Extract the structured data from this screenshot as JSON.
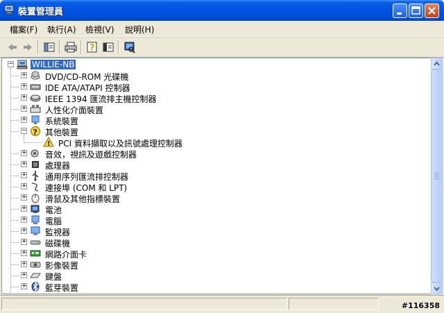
{
  "window": {
    "title": "裝置管理員"
  },
  "menu": [
    {
      "label": "檔案(F)"
    },
    {
      "label": "執行(A)"
    },
    {
      "label": "檢視(V)"
    },
    {
      "label": "說明(H)"
    }
  ],
  "toolbar": [
    {
      "icon": "back-arrow-icon"
    },
    {
      "icon": "forward-arrow-icon"
    },
    {
      "icon": "show-hide-console-tree-icon"
    },
    {
      "icon": "print-icon"
    },
    {
      "icon": "help-icon"
    },
    {
      "icon": "properties-icon"
    },
    {
      "icon": "scan-hardware-icon"
    }
  ],
  "tree": {
    "root": {
      "label": "WILLIE-NB",
      "expanded": true
    },
    "items": [
      {
        "label": "DVD/CD-ROM 光碟機",
        "icon": "cdrom-icon",
        "expander": "+"
      },
      {
        "label": "IDE ATA/ATAPI 控制器",
        "icon": "ide-controller-icon",
        "expander": "+"
      },
      {
        "label": "IEEE 1394 匯流排主機控制器",
        "icon": "firewire-icon",
        "expander": "+"
      },
      {
        "label": "人性化介面裝置",
        "icon": "hid-icon",
        "expander": "+"
      },
      {
        "label": "系統裝置",
        "icon": "system-device-icon",
        "expander": "+"
      },
      {
        "label": "其他裝置",
        "icon": "other-devices-question-icon",
        "expander": "-"
      },
      {
        "label": "PCI 資料擷取以及訊號處理控制器",
        "icon": "unknown-device-warning-icon",
        "expander": "",
        "child": true
      },
      {
        "label": "音效，視訊及遊戲控制器",
        "icon": "sound-icon",
        "expander": "+"
      },
      {
        "label": "處理器",
        "icon": "processor-icon",
        "expander": "+"
      },
      {
        "label": "通用序列匯流排控制器",
        "icon": "usb-icon",
        "expander": "+"
      },
      {
        "label": "連接埠 (COM 和 LPT)",
        "icon": "port-icon",
        "expander": "+"
      },
      {
        "label": "滑鼠及其他指標裝置",
        "icon": "mouse-icon",
        "expander": "+"
      },
      {
        "label": "電池",
        "icon": "battery-icon",
        "expander": "+"
      },
      {
        "label": "電腦",
        "icon": "computer-icon",
        "expander": "+"
      },
      {
        "label": "監視器",
        "icon": "monitor-icon",
        "expander": "+"
      },
      {
        "label": "磁碟機",
        "icon": "disk-drive-icon",
        "expander": "+"
      },
      {
        "label": "網路介面卡",
        "icon": "network-adapter-icon",
        "expander": "+"
      },
      {
        "label": "影像裝置",
        "icon": "imaging-device-icon",
        "expander": "+"
      },
      {
        "label": "鍵盤",
        "icon": "keyboard-icon",
        "expander": "+"
      },
      {
        "label": "藍芽裝置",
        "icon": "bluetooth-icon",
        "expander": "+"
      }
    ]
  },
  "watermark": "#116358"
}
